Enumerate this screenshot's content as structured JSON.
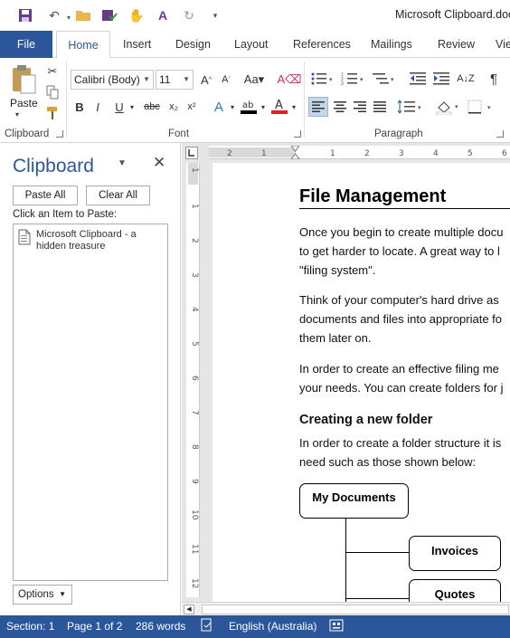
{
  "window": {
    "title": "Microsoft Clipboard.doc"
  },
  "ribbon_tabs": [
    "File",
    "Home",
    "Insert",
    "Design",
    "Layout",
    "References",
    "Mailings",
    "Review",
    "Vie"
  ],
  "clipboard_group": {
    "paste_label": "Paste",
    "group_label": "Clipboard"
  },
  "font_group": {
    "font_name": "Calibri (Body)",
    "font_size": "11",
    "group_label": "Font"
  },
  "paragraph_group": {
    "group_label": "Paragraph"
  },
  "clipboard_pane": {
    "title": "Clipboard",
    "paste_all": "Paste All",
    "clear_all": "Clear All",
    "prompt": "Click an Item to Paste:",
    "items": [
      {
        "text": "Microsoft Clipboard - a hidden treasure"
      }
    ],
    "options_label": "Options"
  },
  "ruler": {
    "h_ticks": [
      "2",
      "1",
      "1",
      "2",
      "3",
      "4",
      "5",
      "6"
    ],
    "v_ticks": [
      "1",
      "1",
      "2",
      "3",
      "4",
      "5",
      "6",
      "7",
      "8",
      "9",
      "10",
      "11",
      "12"
    ]
  },
  "document": {
    "heading": "File Management",
    "para1": [
      "Once you begin to create multiple docu",
      "to get harder to locate. A great way to l",
      "\"filing system\"."
    ],
    "para2": [
      "Think of your computer's hard drive as",
      "documents and files into appropriate fo",
      "them later on."
    ],
    "para3": [
      "In order to create an effective filing me",
      "your needs. You can create folders for j"
    ],
    "subheading": "Creating a new folder",
    "para4": [
      "In order to create a folder structure it is",
      "need such as those shown below:"
    ],
    "org_chart": {
      "root": "My Documents",
      "children": [
        "Invoices",
        "Quotes"
      ]
    }
  },
  "status_bar": {
    "section": "Section: 1",
    "page": "Page 1 of 2",
    "words": "286 words",
    "language": "English (Australia)"
  },
  "colors": {
    "accent": "#2b579a",
    "status_bar": "#2b579a",
    "pane_title": "#2b579a"
  }
}
